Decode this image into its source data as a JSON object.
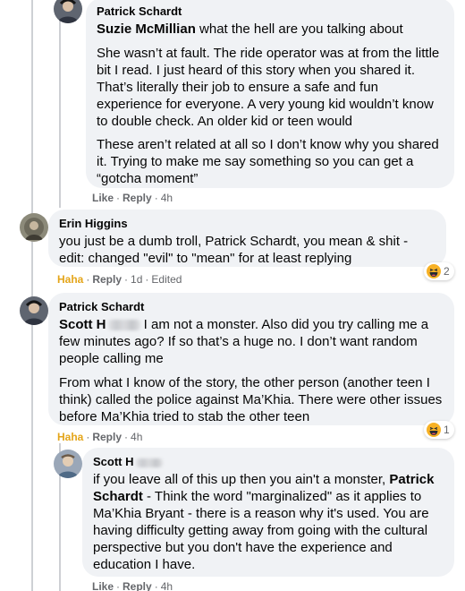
{
  "comments": [
    {
      "author": "Patrick Schardt",
      "mention": "Suzie McMillian",
      "paragraphs": [
        " what the hell are you talking about",
        "She wasn’t at fault. The ride operator was at from the little bit I read. I just heard of this story when you shared it. That’s literally their job to ensure a safe and fun experience for everyone. A very young kid wouldn’t know to double check. An older kid or teen would",
        "These aren’t related at all so I don’t know why you shared it. Trying to make me say something so you can get a “gotcha moment”"
      ],
      "actions": {
        "like": "Like",
        "reply": "Reply",
        "time": "4h"
      }
    },
    {
      "author": "Erin Higgins",
      "text": "you just be a dumb troll, Patrick Schardt, you mean & shit - edit: changed \"evil\" to \"mean\" for at least replying",
      "actions": {
        "reaction": "Haha",
        "reply": "Reply",
        "time": "1d",
        "edited": "Edited"
      },
      "reaction_count": "2"
    },
    {
      "author": "Patrick Schardt",
      "mention": "Scott H",
      "paragraphs": [
        " I am not a monster. Also did you try calling me a few minutes ago? If so that’s a huge no. I don’t want random people calling me",
        "From what I know of the story, the other person (another teen I think) called the police against Ma’Khia. There were other issues before Ma’Khia tried to stab the other teen"
      ],
      "actions": {
        "reaction": "Haha",
        "reply": "Reply",
        "time": "4h"
      },
      "reaction_count": "1"
    },
    {
      "author": "Scott H",
      "text_before": "if you leave all of this up then you ain't a monster, ",
      "mention": "Patrick Schardt",
      "text_after": " - Think the word \"marginalized\" as it applies to Ma’Khia Bryant - there is a reason why it's used. You are having difficulty getting away from going with the cultural perspective but you don't have the experience and education I have.",
      "actions": {
        "like": "Like",
        "reply": "Reply",
        "time": "4h"
      }
    }
  ],
  "icons": {
    "reaction": "haha-emoji-icon"
  },
  "colors": {
    "bubble": "#f0f2f5",
    "meta": "#65676b",
    "haha": "#e4a51a",
    "thread": "#ced0d4"
  }
}
